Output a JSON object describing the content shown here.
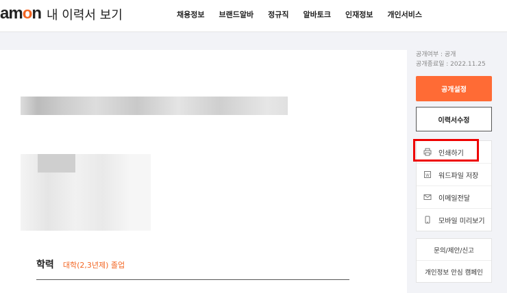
{
  "header": {
    "logo": "amon",
    "page_title": "내 이력서 보기",
    "nav": [
      "채용정보",
      "브랜드알바",
      "정규직",
      "알바토크",
      "인재정보",
      "개인서비스"
    ]
  },
  "resume": {
    "section_title": "학력",
    "section_sub": "대학(2,3년제) 졸업"
  },
  "sidebar": {
    "public_status": "공개여부 : 공개",
    "public_end": "공개종료일 : 2022.11.25",
    "public_settings_label": "공개설정",
    "edit_label": "이력서수정",
    "actions": [
      {
        "label": "인쇄하기",
        "icon": "printer-icon"
      },
      {
        "label": "워드파일 저장",
        "icon": "word-file-icon"
      },
      {
        "label": "이메일전달",
        "icon": "mail-icon"
      },
      {
        "label": "모바일 미리보기",
        "icon": "mobile-icon"
      }
    ],
    "links": [
      "문의/제안/신고",
      "개인정보 안심 캠페인"
    ]
  },
  "colors": {
    "accent": "#ff6b35",
    "highlight": "#e00000"
  }
}
